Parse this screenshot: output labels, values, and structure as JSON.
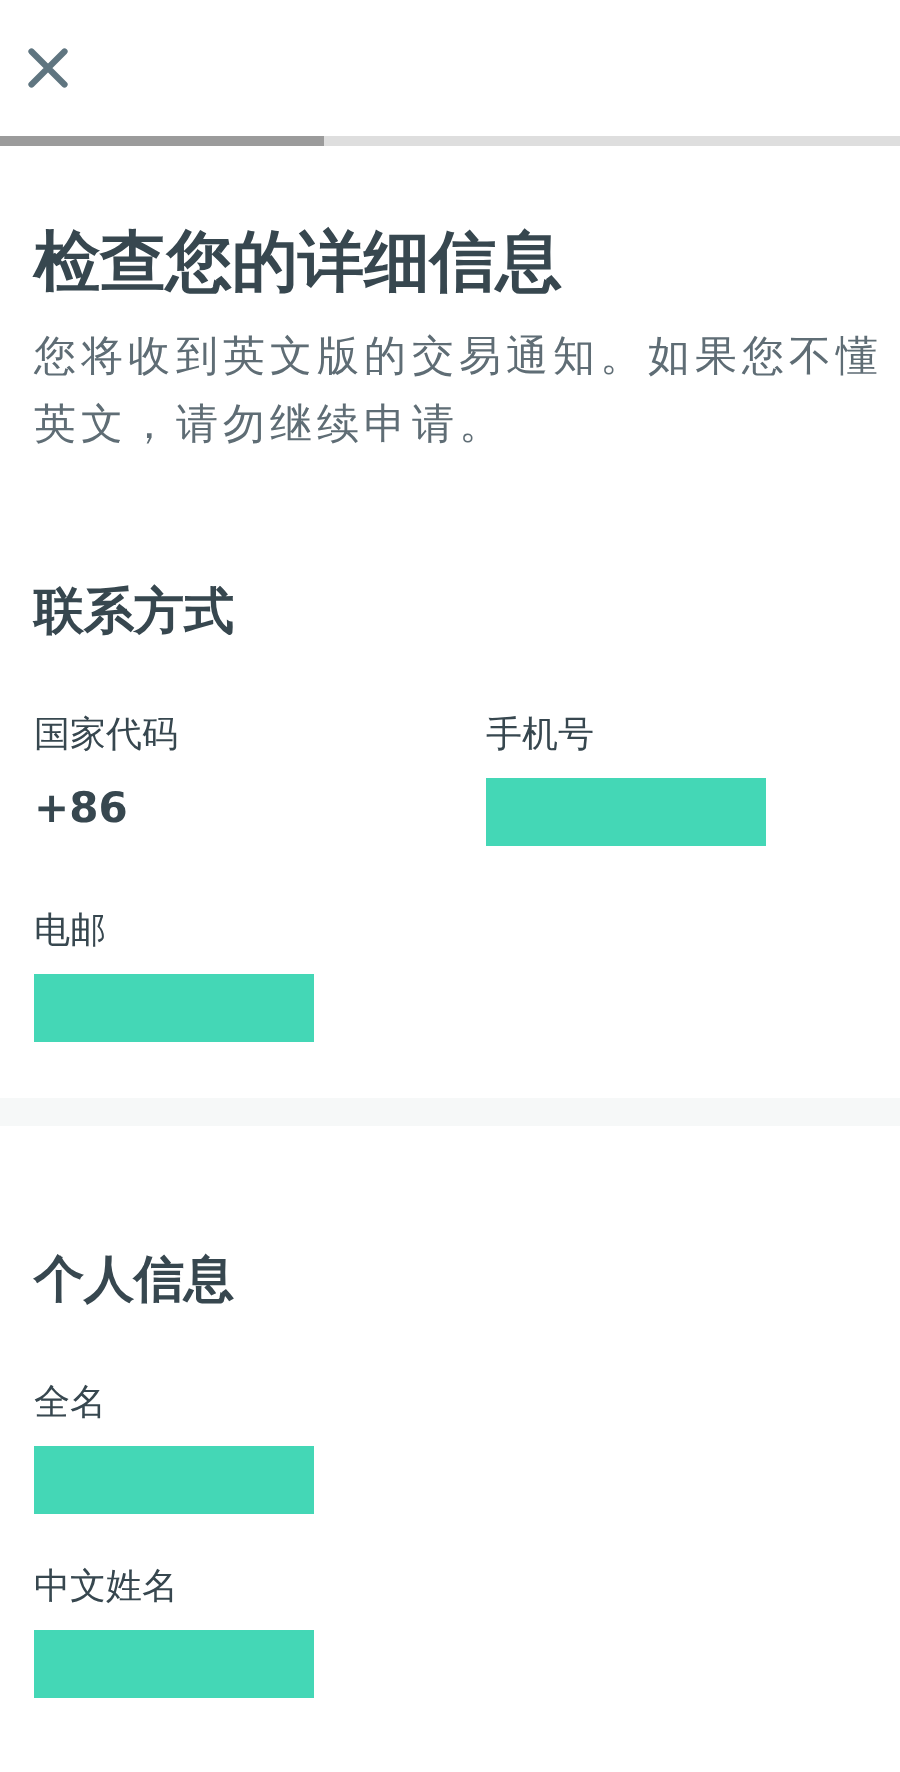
{
  "progress": {
    "level": 0.36
  },
  "title": "检查您的详细信息",
  "subtitle": "您将收到英文版的交易通知。如果您不懂英文，请勿继续申请。",
  "sections": [
    {
      "heading": "联系方式",
      "kind": "grid",
      "fields": [
        {
          "label": "国家代码",
          "kind": "text",
          "value": "+86"
        },
        {
          "label": "手机号",
          "kind": "redacted"
        },
        {
          "label": "电邮",
          "kind": "redacted"
        }
      ]
    },
    {
      "heading": "个人信息",
      "kind": "list",
      "fields": [
        {
          "label": "全名",
          "kind": "redacted"
        },
        {
          "label": "中文姓名",
          "kind": "redacted"
        }
      ]
    }
  ]
}
